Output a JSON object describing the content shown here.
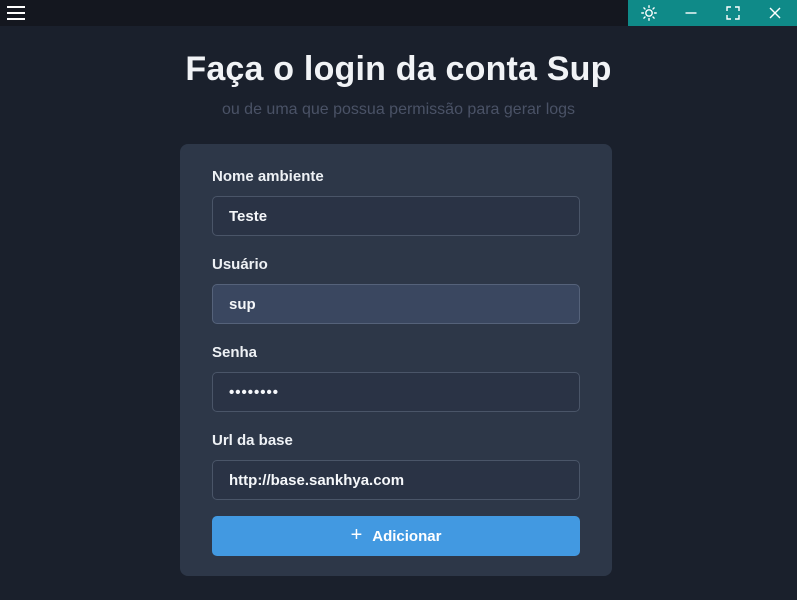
{
  "page": {
    "title": "Faça o login da conta Sup",
    "subtitle": "ou de uma que possua permissão para gerar logs"
  },
  "form": {
    "environment_label": "Nome ambiente",
    "environment_value": "Teste",
    "user_label": "Usuário",
    "user_value": "sup",
    "password_label": "Senha",
    "password_value": "••••••••",
    "url_label": "Url da base",
    "url_value": "http://base.sankhya.com",
    "add_button_label": "Adicionar"
  },
  "icons": {
    "menu": "hamburger-icon",
    "theme": "sun-icon",
    "minimize": "minimize-icon",
    "fullscreen": "fullscreen-icon",
    "close": "close-icon",
    "add": "plus-icon"
  },
  "colors": {
    "background": "#1a202c",
    "card": "#2d3748",
    "accent": "#4299e1",
    "window_controls": "#0f8a88"
  }
}
